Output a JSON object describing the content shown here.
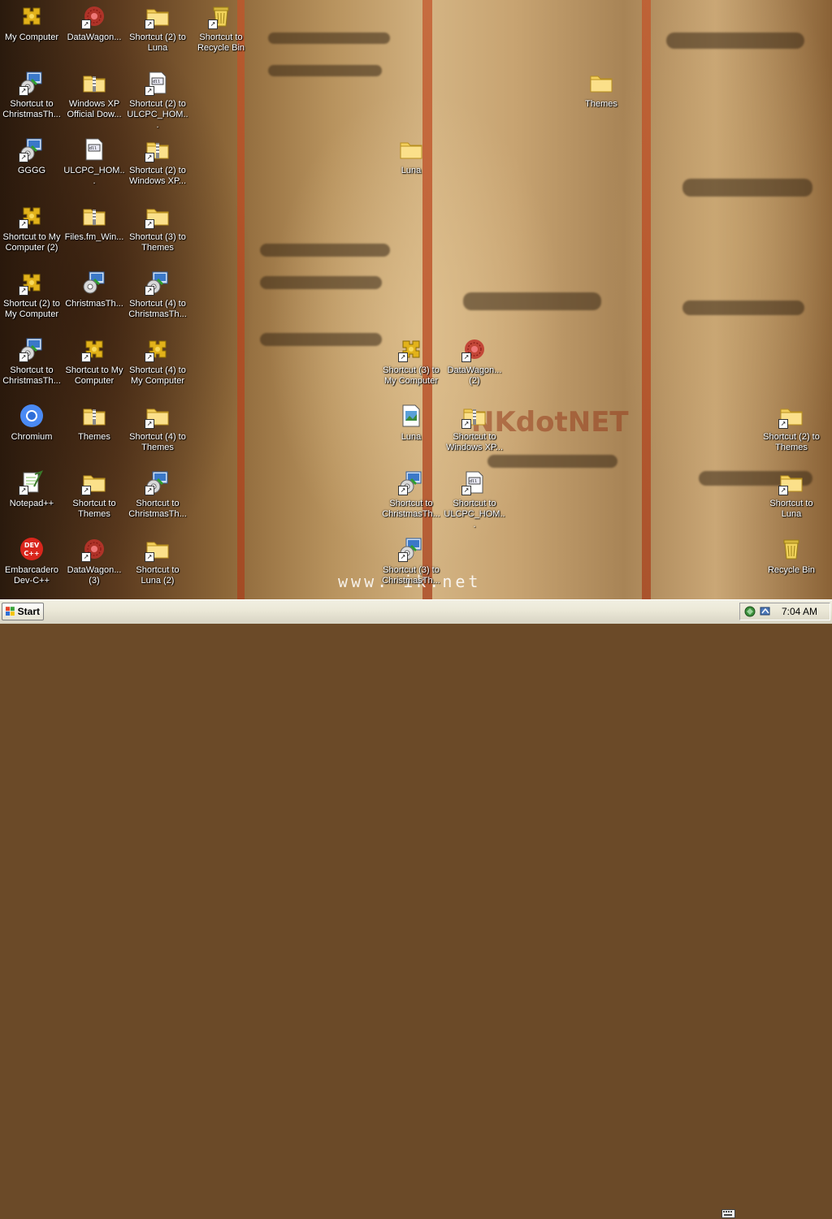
{
  "desktop": {
    "wallpaper_text": "NKdotNET",
    "wallpaper_url_text": "www.      ik.net",
    "icons": [
      {
        "label": "My Computer",
        "type": "mycomputer",
        "shortcut": false
      },
      {
        "label": "DataWagon...",
        "type": "datawagon",
        "shortcut": true
      },
      {
        "label": "Shortcut (2) to\nLuna",
        "type": "folder",
        "shortcut": true
      },
      {
        "label": "Shortcut to\nRecycle Bin",
        "type": "recycle",
        "shortcut": true
      },
      {
        "label": "Shortcut to\nChristmasTh...",
        "type": "installer",
        "shortcut": true
      },
      {
        "label": "Windows XP\nOfficial Dow...",
        "type": "zipfolder",
        "shortcut": false
      },
      {
        "label": "Shortcut (2) to\nULCPC_HOM...",
        "type": "document",
        "shortcut": true
      },
      {
        "label": "Themes",
        "type": "folder",
        "shortcut": false
      },
      {
        "label": "Luna",
        "type": "folder",
        "shortcut": false
      },
      {
        "label": "GGGG",
        "type": "installer",
        "shortcut": true
      },
      {
        "label": "ULCPC_HOM...",
        "type": "document",
        "shortcut": false
      },
      {
        "label": "Shortcut (2) to\nWindows XP...",
        "type": "zipfolder",
        "shortcut": true
      },
      {
        "label": "Shortcut to My\nComputer (2)",
        "type": "mycomputer",
        "shortcut": true
      },
      {
        "label": "Files.fm_Win...",
        "type": "zipfolder",
        "shortcut": false
      },
      {
        "label": "Shortcut (3) to\nThemes",
        "type": "folder",
        "shortcut": true
      },
      {
        "label": "Shortcut (2) to\nMy Computer",
        "type": "mycomputer",
        "shortcut": true
      },
      {
        "label": "ChristmasTh...",
        "type": "installer",
        "shortcut": false
      },
      {
        "label": "Shortcut (4) to\nChristmasTh...",
        "type": "installer",
        "shortcut": true
      },
      {
        "label": "Shortcut to\nChristmasTh...",
        "type": "installer",
        "shortcut": true
      },
      {
        "label": "Shortcut to My\nComputer",
        "type": "mycomputer",
        "shortcut": true
      },
      {
        "label": "Shortcut (4) to\nMy Computer",
        "type": "mycomputer",
        "shortcut": true
      },
      {
        "label": "Shortcut (3) to\nMy Computer",
        "type": "mycomputer",
        "shortcut": true
      },
      {
        "label": "DataWagon...\n(2)",
        "type": "datawagon",
        "shortcut": true
      },
      {
        "label": "Chromium",
        "type": "chromium",
        "shortcut": false
      },
      {
        "label": "Themes",
        "type": "zipfolder",
        "shortcut": false
      },
      {
        "label": "Shortcut (4) to\nThemes",
        "type": "folder",
        "shortcut": true
      },
      {
        "label": "Luna",
        "type": "image",
        "shortcut": false
      },
      {
        "label": "Shortcut to\nWindows XP...",
        "type": "zipfolder",
        "shortcut": true
      },
      {
        "label": "Shortcut (2) to\nThemes",
        "type": "folder",
        "shortcut": true
      },
      {
        "label": "Notepad++",
        "type": "notepad",
        "shortcut": true
      },
      {
        "label": "Shortcut to\nThemes",
        "type": "folder",
        "shortcut": true
      },
      {
        "label": "Shortcut to\nChristmasTh...",
        "type": "installer",
        "shortcut": true
      },
      {
        "label": "Shortcut to\nChristmasTh...",
        "type": "installer",
        "shortcut": true
      },
      {
        "label": "Shortcut to\nULCPC_HOM...",
        "type": "document",
        "shortcut": true
      },
      {
        "label": "Shortcut to\nLuna",
        "type": "folder",
        "shortcut": true
      },
      {
        "label": "Embarcadero\nDev-C++",
        "type": "devcpp",
        "shortcut": false
      },
      {
        "label": "DataWagon...\n(3)",
        "type": "datawagon",
        "shortcut": true
      },
      {
        "label": "Shortcut to\nLuna (2)",
        "type": "folder",
        "shortcut": true
      },
      {
        "label": "Shortcut (3) to\nChristmasTh...",
        "type": "installer",
        "shortcut": true
      },
      {
        "label": "Recycle Bin",
        "type": "recycle",
        "shortcut": false
      }
    ]
  },
  "taskbar": {
    "start_label": "Start",
    "clock": "7:04 AM"
  }
}
